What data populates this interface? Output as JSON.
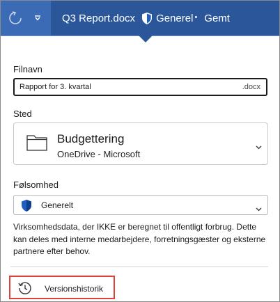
{
  "titlebar": {
    "document_name": "Q3 Report.docx",
    "sensitivity": "Generel",
    "sensitivity_dot": "•",
    "status": "Gemt"
  },
  "filename": {
    "label": "Filnavn",
    "value": "Rapport for 3. kvartal",
    "extension": ".docx"
  },
  "location": {
    "label": "Sted",
    "folder": "Budgettering",
    "provider": "OneDrive - Microsoft"
  },
  "sensitivity": {
    "label": "Følsomhed",
    "value": "Generelt",
    "description": "Virksomhedsdata, der IKKE er beregnet til offentligt forbrug. Dette kan deles med interne medarbejdere, forretningsgæster og eksterne partnere efter behov."
  },
  "version_history": {
    "label": "Versionshistorik"
  },
  "colors": {
    "titlebar": "#2b579a",
    "titlebar_left": "#3c6bb5",
    "shield_blue": "#1f5fbf",
    "highlight_red": "#e0413a"
  },
  "icons": [
    "refresh-icon",
    "dropdown-caret-icon",
    "shield-icon",
    "folder-icon",
    "chevron-down-icon",
    "history-icon"
  ]
}
